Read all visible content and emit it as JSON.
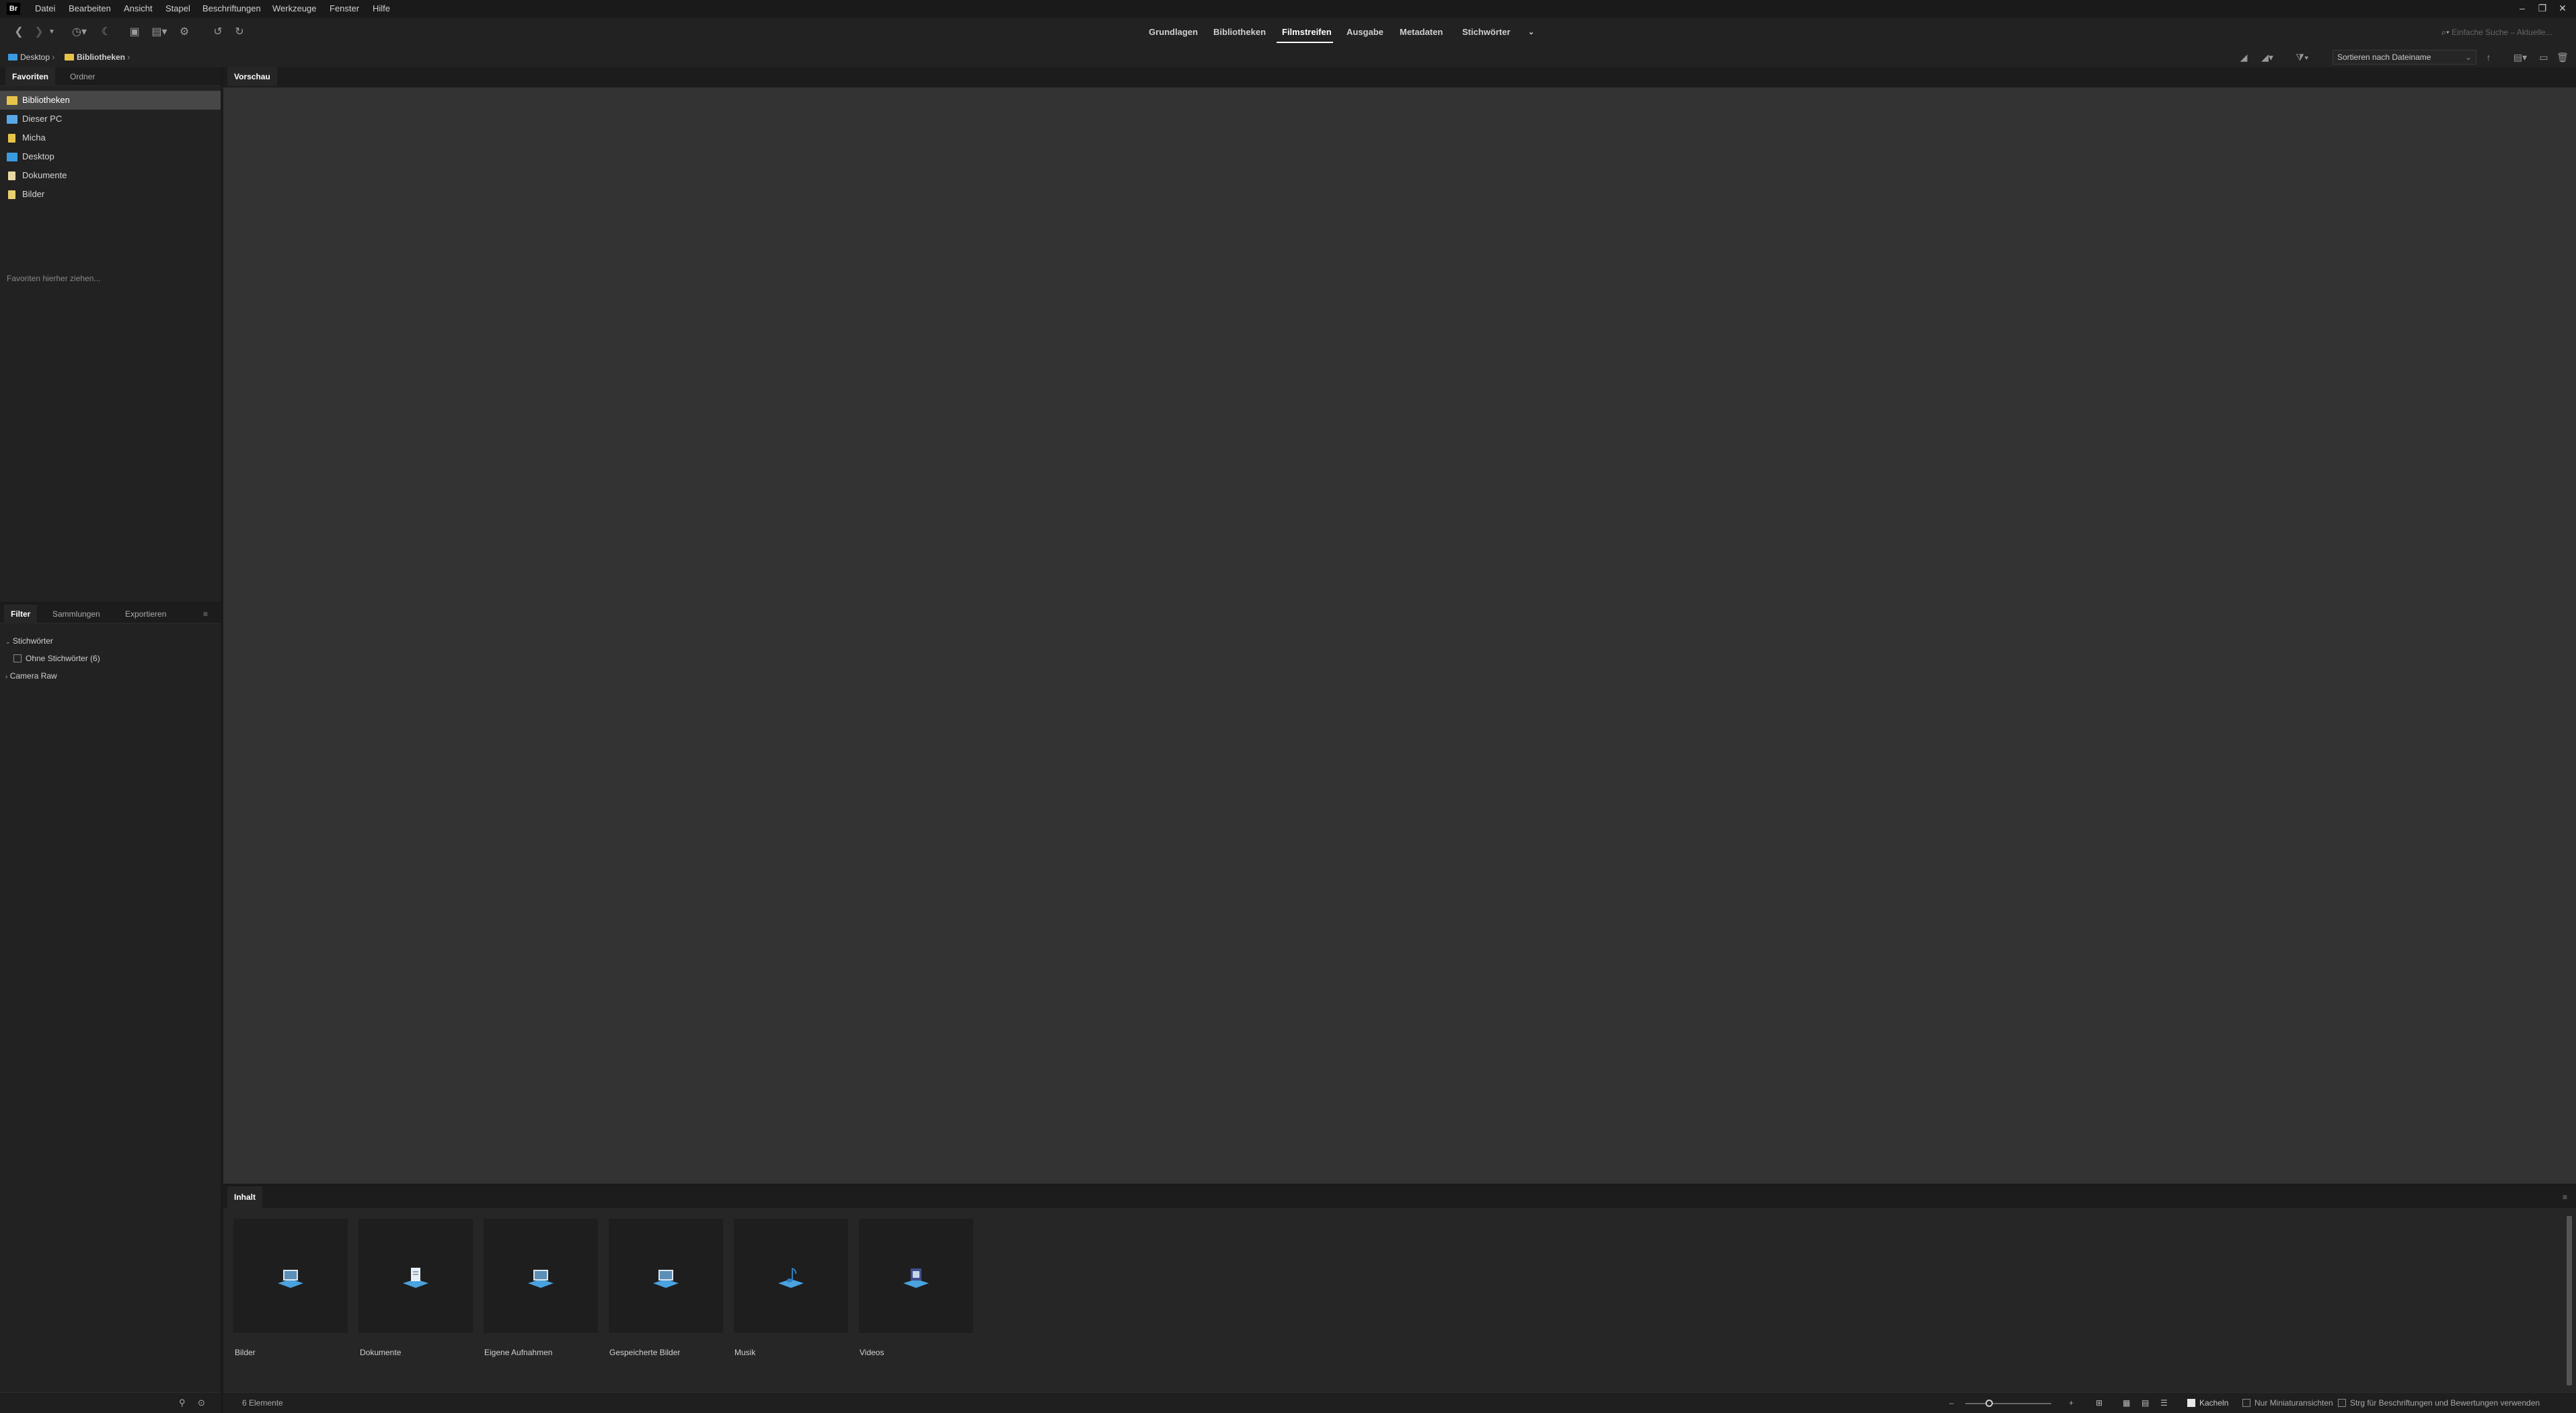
{
  "app": {
    "logo": "Br"
  },
  "menu": [
    "Datei",
    "Bearbeiten",
    "Ansicht",
    "Stapel",
    "Beschriftungen",
    "Werkzeuge",
    "Fenster",
    "Hilfe"
  ],
  "workspaces": [
    "Grundlagen",
    "Bibliotheken",
    "Filmstreifen",
    "Ausgabe",
    "Metadaten",
    "Stichwörter"
  ],
  "active_workspace": "Filmstreifen",
  "search": {
    "placeholder": "Einfache Suche – Aktuelle..."
  },
  "path": [
    "Desktop",
    "Bibliotheken"
  ],
  "sort": {
    "label": "Sortieren nach Dateiname"
  },
  "left_tabs": {
    "favorites": "Favoriten",
    "folders": "Ordner"
  },
  "favorites": [
    {
      "label": "Bibliotheken",
      "icon": "library-folder-icon",
      "color": "#e8c349",
      "selected": true
    },
    {
      "label": "Dieser PC",
      "icon": "computer-icon",
      "color": "#58a8e8"
    },
    {
      "label": "Micha",
      "icon": "user-folder-icon",
      "color": "#e8c349"
    },
    {
      "label": "Desktop",
      "icon": "desktop-folder-icon",
      "color": "#3a9be0"
    },
    {
      "label": "Dokumente",
      "icon": "documents-folder-icon",
      "color": "#e8d9a3"
    },
    {
      "label": "Bilder",
      "icon": "pictures-folder-icon",
      "color": "#e8d070"
    }
  ],
  "favorites_hint": "Favoriten hierher ziehen...",
  "filter_tabs": {
    "filter": "Filter",
    "collections": "Sammlungen",
    "export": "Exportieren"
  },
  "filter": {
    "group1": "Stichwörter",
    "item1": "Ohne Stichwörter (6)",
    "group2": "Camera Raw"
  },
  "preview_tab": "Vorschau",
  "content_tab": "Inhalt",
  "content_items": [
    {
      "label": "Bilder",
      "icon": "pictures-library-icon"
    },
    {
      "label": "Dokumente",
      "icon": "documents-library-icon"
    },
    {
      "label": "Eigene Aufnahmen",
      "icon": "camera-roll-library-icon"
    },
    {
      "label": "Gespeicherte Bilder",
      "icon": "saved-pictures-library-icon"
    },
    {
      "label": "Musik",
      "icon": "music-library-icon"
    },
    {
      "label": "Videos",
      "icon": "videos-library-icon"
    }
  ],
  "status": {
    "count": "6 Elemente",
    "tiles": "Kacheln",
    "thumbs_only": "Nur Miniaturansichten",
    "ctrl_hint": "Strg für Beschriftungen und Bewertungen verwenden"
  }
}
